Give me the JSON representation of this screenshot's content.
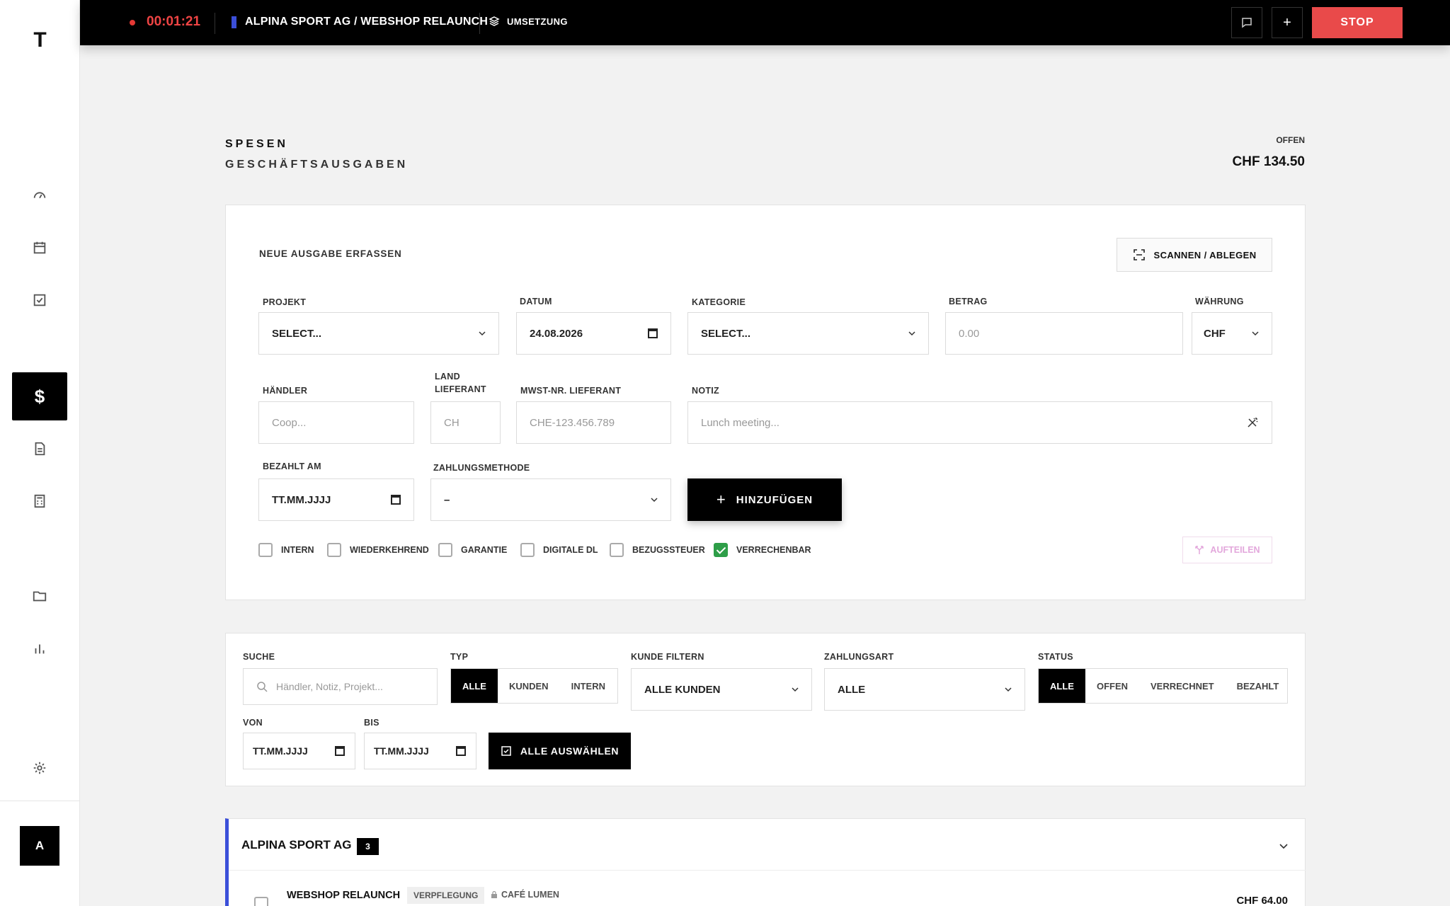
{
  "sidebar": {
    "logo": "T",
    "active_symbol": "$",
    "avatar": "A"
  },
  "topbar": {
    "timer": "00:01:21",
    "project": "ALPINA SPORT AG / WEBSHOP RELAUNCH",
    "phase": "UMSETZUNG",
    "stop_label": "STOP",
    "add_symbol": "+"
  },
  "header": {
    "title": "SPESEN",
    "subtitle": "GESCHÄFTSAUSGABEN",
    "open_label": "OFFEN",
    "open_amount": "CHF 134.50"
  },
  "form": {
    "section_title": "NEUE AUSGABE ERFASSEN",
    "scan_label": "SCANNEN / ABLEGEN",
    "projekt_label": "PROJEKT",
    "projekt_value": "SELECT...",
    "datum_label": "DATUM",
    "datum_value": "24.08.2026",
    "kategorie_label": "KATEGORIE",
    "kategorie_value": "SELECT...",
    "betrag_label": "BETRAG",
    "betrag_placeholder": "0.00",
    "waehrung_label": "WÄHRUNG",
    "waehrung_value": "CHF",
    "haendler_label": "HÄNDLER",
    "haendler_placeholder": "Coop...",
    "land_label_1": "LAND",
    "land_label_2": "LIEFERANT",
    "land_placeholder": "CH",
    "mwst_label": "MWST-NR. LIEFERANT",
    "mwst_placeholder": "CHE-123.456.789",
    "notiz_label": "NOTIZ",
    "notiz_placeholder": "Lunch meeting...",
    "bezahlt_label": "BEZAHLT AM",
    "bezahlt_value": "TT.MM.JJJJ",
    "zahlungsmethode_label": "ZAHLUNGSMETHODE",
    "zahlungsmethode_value": "–",
    "add_label": "HINZUFÜGEN",
    "checkboxes": [
      "INTERN",
      "WIEDERKEHREND",
      "GARANTIE",
      "DIGITALE DL",
      "BEZUGSSTEUER",
      "VERRECHENBAR"
    ],
    "split_label": "AUFTEILEN"
  },
  "filter": {
    "suche_label": "SUCHE",
    "suche_placeholder": "Händler, Notiz, Projekt...",
    "typ_label": "TYP",
    "typ_options": [
      "ALLE",
      "KUNDEN",
      "INTERN"
    ],
    "kunde_label": "KUNDE FILTERN",
    "kunde_value": "ALLE KUNDEN",
    "zahlungsart_label": "ZAHLUNGSART",
    "zahlungsart_value": "ALLE",
    "status_label": "STATUS",
    "status_options": [
      "ALLE",
      "OFFEN",
      "VERRECHNET",
      "BEZAHLT"
    ],
    "von_label": "VON",
    "von_value": "TT.MM.JJJJ",
    "bis_label": "BIS",
    "bis_value": "TT.MM.JJJJ",
    "select_all_label": "ALLE AUSWÄHLEN"
  },
  "group": {
    "client": "ALPINA SPORT AG",
    "count": "3",
    "row": {
      "project": "WEBSHOP RELAUNCH",
      "category": "VERPFLEGUNG",
      "merchant": "CAFÉ LUMEN",
      "amount": "CHF 64.00"
    }
  }
}
